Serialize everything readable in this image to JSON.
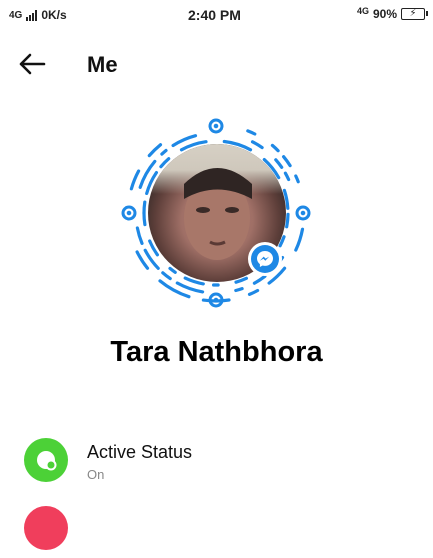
{
  "status_bar": {
    "network_left": "4G",
    "speed": "0K/s",
    "time": "2:40 PM",
    "network_right": "4G",
    "battery_percent": "90%"
  },
  "header": {
    "title": "Me"
  },
  "profile": {
    "name": "Tara Nathbhora"
  },
  "settings": [
    {
      "title": "Active Status",
      "subtitle": "On",
      "icon": "active-status-icon",
      "color": "#4cd137"
    },
    {
      "title": "",
      "subtitle": "",
      "icon": "settings-item-icon",
      "color": "#f03e5c"
    }
  ],
  "colors": {
    "code_blue": "#1e88e5",
    "active_green": "#4cd137",
    "next_red": "#f03e5c"
  }
}
